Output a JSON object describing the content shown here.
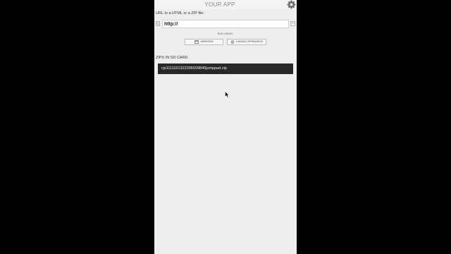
{
  "app": {
    "title": "YOUR APP"
  },
  "icons": {
    "settings": "gear-icon",
    "window": "window-icon",
    "canvas": "circle-check-icon",
    "clear": "minus-icon"
  },
  "url_section": {
    "label": "URL to a HTML or a ZIP file:",
    "value": "http://",
    "clear_label": "—"
  },
  "run": {
    "label": "RUN USING:",
    "webview_label": "WEBVIEW",
    "canvas_label": "CANVAS ZIP/BUNDLE"
  },
  "zips": {
    "label": "ZIPS IN SD CARD",
    "items": [
      "cjs1111101322396509846jumppad.zip"
    ]
  },
  "colors": {
    "phone_bg": "#eeeeee",
    "zip_item_bg": "#282828",
    "title_color": "#8a8a8a"
  }
}
